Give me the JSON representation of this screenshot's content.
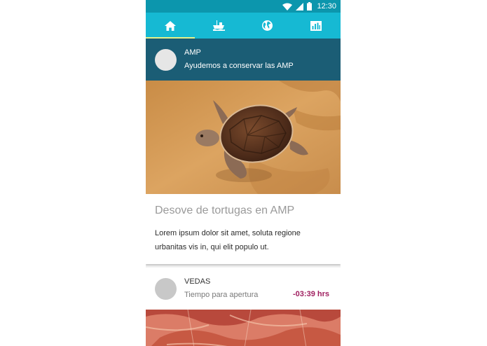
{
  "status_bar": {
    "time": "12:30",
    "icons": [
      "wifi-icon",
      "signal-icon",
      "battery-icon"
    ],
    "background": "#0c96ad"
  },
  "tabs": [
    {
      "icon": "home-icon",
      "active": true
    },
    {
      "icon": "boat-icon",
      "active": false
    },
    {
      "icon": "globe-icon",
      "active": false
    },
    {
      "icon": "bar-chart-icon",
      "active": false
    }
  ],
  "colors": {
    "tab_bar": "#16b9d3",
    "active_indicator": "#e6f28a",
    "card_header": "#1b5d75",
    "countdown": "#a02060"
  },
  "card1": {
    "title": "AMP",
    "subtitle": "Ayudemos a conservar las AMP",
    "image": "sea-turtle-on-sand",
    "heading": "Desove de tortugas en AMP",
    "body": "Lorem ipsum dolor sit amet, soluta regione urbanitas vis in, qui elit populo ut."
  },
  "card2": {
    "title": "VEDAS",
    "subtitle": "Tiempo para apertura",
    "countdown": "-03:39 hrs",
    "image": "shrimp"
  }
}
